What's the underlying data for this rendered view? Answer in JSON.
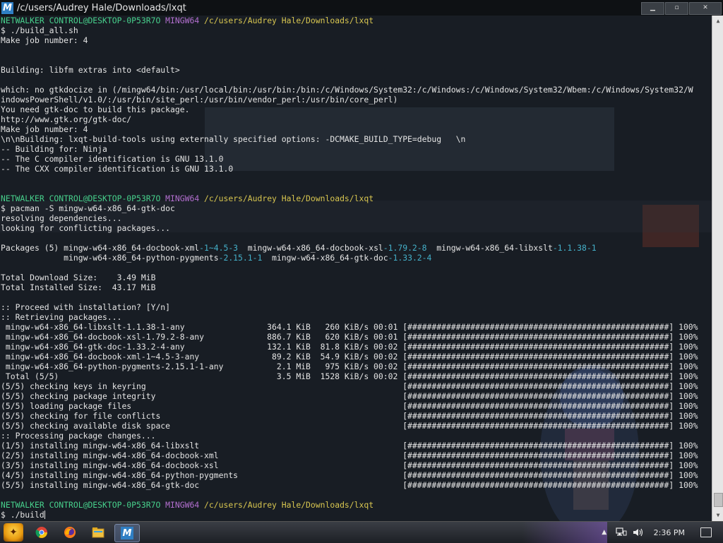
{
  "window": {
    "title": "/c/users/Audrey Hale/Downloads/lxqt",
    "app_icon": "M",
    "buttons": {
      "minimize": "▁",
      "maximize": "▫",
      "close": "✕"
    }
  },
  "terminal": {
    "lines": [
      [
        {
          "t": "NETWALKER CONTROL@DESKTOP-0P53R7O",
          "c": "host"
        },
        {
          "t": " "
        },
        {
          "t": "MINGW64",
          "c": "env"
        },
        {
          "t": " "
        },
        {
          "t": "/c/users/Audrey Hale/Downloads/lxqt",
          "c": "path"
        }
      ],
      [
        {
          "t": "$ ./build_all.sh"
        }
      ],
      [
        {
          "t": "Make job number: 4"
        }
      ],
      [
        {
          "t": ""
        }
      ],
      [
        {
          "t": ""
        }
      ],
      [
        {
          "t": "Building: libfm extras into <default>"
        }
      ],
      [
        {
          "t": ""
        }
      ],
      [
        {
          "t": "which: no gtkdocize in (/mingw64/bin:/usr/local/bin:/usr/bin:/bin:/c/Windows/System32:/c/Windows:/c/Windows/System32/Wbem:/c/Windows/System32/W"
        }
      ],
      [
        {
          "t": "indowsPowerShell/v1.0/:/usr/bin/site_perl:/usr/bin/vendor_perl:/usr/bin/core_perl)"
        }
      ],
      [
        {
          "t": "You need gtk-doc to build this package."
        }
      ],
      [
        {
          "t": "http://www.gtk.org/gtk-doc/"
        }
      ],
      [
        {
          "t": "Make job number: 4"
        }
      ],
      [
        {
          "t": "\\n\\nBuilding: lxqt-build-tools using externally specified options: -DCMAKE_BUILD_TYPE=debug   \\n"
        }
      ],
      [
        {
          "t": "-- Building for: Ninja"
        }
      ],
      [
        {
          "t": "-- The C compiler identification is GNU 13.1.0"
        }
      ],
      [
        {
          "t": "-- The CXX compiler identification is GNU 13.1.0"
        }
      ],
      [
        {
          "t": ""
        }
      ],
      [
        {
          "t": ""
        }
      ],
      [
        {
          "t": "NETWALKER CONTROL@DESKTOP-0P53R7O",
          "c": "host"
        },
        {
          "t": " "
        },
        {
          "t": "MINGW64",
          "c": "env"
        },
        {
          "t": " "
        },
        {
          "t": "/c/users/Audrey Hale/Downloads/lxqt",
          "c": "path"
        }
      ],
      [
        {
          "t": "$ pacman -S mingw-w64-x86_64-gtk-doc"
        }
      ],
      [
        {
          "t": "resolving dependencies..."
        }
      ],
      [
        {
          "t": "looking for conflicting packages..."
        }
      ],
      [
        {
          "t": ""
        }
      ],
      [
        {
          "t": "Packages (5) mingw-w64-x86_64-docbook-xml"
        },
        {
          "t": "-1~4.5-3",
          "c": "ver"
        },
        {
          "t": "  mingw-w64-x86_64-docbook-xsl"
        },
        {
          "t": "-1.79.2-8",
          "c": "ver"
        },
        {
          "t": "  mingw-w64-x86_64-libxslt"
        },
        {
          "t": "-1.1.38-1",
          "c": "ver"
        }
      ],
      [
        {
          "t": "             mingw-w64-x86_64-python-pygments"
        },
        {
          "t": "-2.15.1-1",
          "c": "ver"
        },
        {
          "t": "  mingw-w64-x86_64-gtk-doc"
        },
        {
          "t": "-1.33.2-4",
          "c": "ver"
        }
      ],
      [
        {
          "t": ""
        }
      ],
      [
        {
          "t": "Total Download Size:    3.49 MiB"
        }
      ],
      [
        {
          "t": "Total Installed Size:  43.17 MiB"
        }
      ],
      [
        {
          "t": ""
        }
      ],
      [
        {
          "t": ":: Proceed with installation? [Y/n]"
        }
      ],
      [
        {
          "t": ":: Retrieving packages..."
        }
      ],
      [
        {
          "t": " mingw-w64-x86_64-libxslt-1.1.38-1-any                 364.1 KiB   260 KiB/s 00:01 [######################################################] 100%"
        }
      ],
      [
        {
          "t": " mingw-w64-x86_64-docbook-xsl-1.79.2-8-any             886.7 KiB   620 KiB/s 00:01 [######################################################] 100%"
        }
      ],
      [
        {
          "t": " mingw-w64-x86_64-gtk-doc-1.33.2-4-any                 132.1 KiB  81.8 KiB/s 00:02 [######################################################] 100%"
        }
      ],
      [
        {
          "t": " mingw-w64-x86_64-docbook-xml-1~4.5-3-any               89.2 KiB  54.9 KiB/s 00:02 [######################################################] 100%"
        }
      ],
      [
        {
          "t": " mingw-w64-x86_64-python-pygments-2.15.1-1-any           2.1 MiB   975 KiB/s 00:02 [######################################################] 100%"
        }
      ],
      [
        {
          "t": " Total (5/5)                                             3.5 MiB  1528 KiB/s 00:02 [######################################################] 100%"
        }
      ],
      [
        {
          "t": "(5/5) checking keys in keyring                                                     [######################################################] 100%"
        }
      ],
      [
        {
          "t": "(5/5) checking package integrity                                                   [######################################################] 100%"
        }
      ],
      [
        {
          "t": "(5/5) loading package files                                                        [######################################################] 100%"
        }
      ],
      [
        {
          "t": "(5/5) checking for file conflicts                                                  [######################################################] 100%"
        }
      ],
      [
        {
          "t": "(5/5) checking available disk space                                                [######################################################] 100%"
        }
      ],
      [
        {
          "t": ":: Processing package changes..."
        }
      ],
      [
        {
          "t": "(1/5) installing mingw-w64-x86_64-libxslt                                          [######################################################] 100%"
        }
      ],
      [
        {
          "t": "(2/5) installing mingw-w64-x86_64-docbook-xml                                      [######################################################] 100%"
        }
      ],
      [
        {
          "t": "(3/5) installing mingw-w64-x86_64-docbook-xsl                                      [######################################################] 100%"
        }
      ],
      [
        {
          "t": "(4/5) installing mingw-w64-x86_64-python-pygments                                  [######################################################] 100%"
        }
      ],
      [
        {
          "t": "(5/5) installing mingw-w64-x86_64-gtk-doc                                          [######################################################] 100%"
        }
      ],
      [
        {
          "t": ""
        }
      ],
      [
        {
          "t": "NETWALKER CONTROL@DESKTOP-0P53R7O",
          "c": "host"
        },
        {
          "t": " "
        },
        {
          "t": "MINGW64",
          "c": "env"
        },
        {
          "t": " "
        },
        {
          "t": "/c/users/Audrey Hale/Downloads/lxqt",
          "c": "path"
        }
      ],
      [
        {
          "t": "$ ./build",
          "cursor": true
        }
      ]
    ]
  },
  "colors": {
    "host": "#47d18c",
    "path": "#d8c650",
    "env": "#b36fd0",
    "version": "#44b0c9",
    "text": "#e4e4e4"
  },
  "taskbar": {
    "start": "start-orb-icon",
    "apps": [
      {
        "name": "chrome-icon",
        "active": false
      },
      {
        "name": "firefox-icon",
        "active": false
      },
      {
        "name": "file-explorer-icon",
        "active": false
      },
      {
        "name": "terminal-icon",
        "active": true
      }
    ],
    "tray": {
      "show_hidden": "▲",
      "clock": "2:36 PM"
    }
  }
}
